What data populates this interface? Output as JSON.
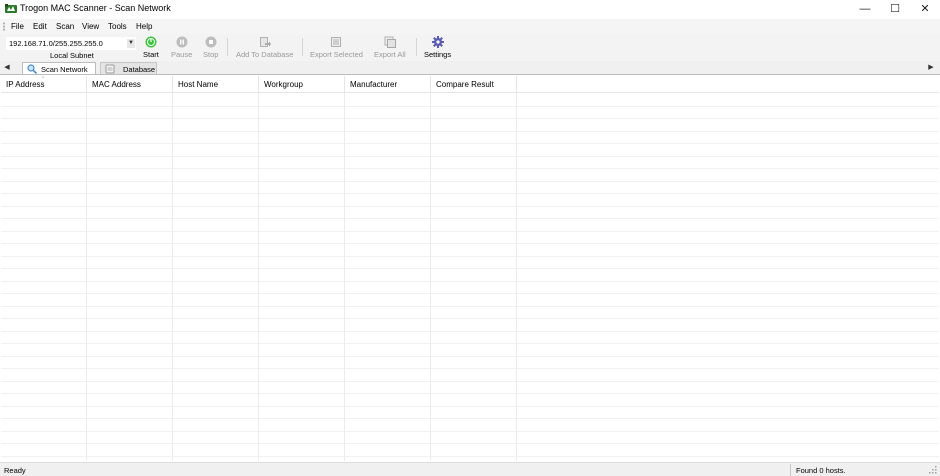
{
  "window": {
    "title": "Trogon MAC Scanner - Scan Network",
    "minimize_glyph": "—",
    "maximize_glyph": "☐",
    "close_glyph": "✕"
  },
  "menu": {
    "items": [
      {
        "label": "File"
      },
      {
        "label": "Edit"
      },
      {
        "label": "Scan"
      },
      {
        "label": "View"
      },
      {
        "label": "Tools"
      },
      {
        "label": "Help"
      }
    ]
  },
  "toolbar": {
    "subnet_value": "192.168.71.0/255.255.255.0",
    "subnet_label": "Local Subnet",
    "start_label": "Start",
    "pause_label": "Pause",
    "stop_label": "Stop",
    "add_to_database_label": "Add To Database",
    "export_selected_label": "Export Selected",
    "export_all_label": "Export All",
    "settings_label": "Settings"
  },
  "tabs": {
    "items": [
      {
        "label": "Scan Network",
        "active": true
      },
      {
        "label": "Database",
        "active": false
      }
    ]
  },
  "table": {
    "columns": [
      {
        "label": "IP Address"
      },
      {
        "label": "MAC Address"
      },
      {
        "label": "Host Name"
      },
      {
        "label": "Workgroup"
      },
      {
        "label": "Manufacturer"
      },
      {
        "label": "Compare Result"
      }
    ],
    "rows": []
  },
  "status": {
    "left_text": "Ready",
    "right_text": "Found 0 hosts."
  },
  "colors": {
    "start_green": "#3cc13c",
    "disabled_gray": "#9a9a9a",
    "settings_purple": "#5b5bb0"
  },
  "icons": {
    "app": "trogon-app-icon",
    "start": "start-icon",
    "pause": "pause-icon",
    "stop": "stop-icon",
    "add_to_database": "add-database-icon",
    "export_selected": "export-selected-icon",
    "export_all": "export-all-icon",
    "settings": "gear-icon",
    "scan_tab": "magnifier-icon",
    "database_tab": "database-icon"
  }
}
